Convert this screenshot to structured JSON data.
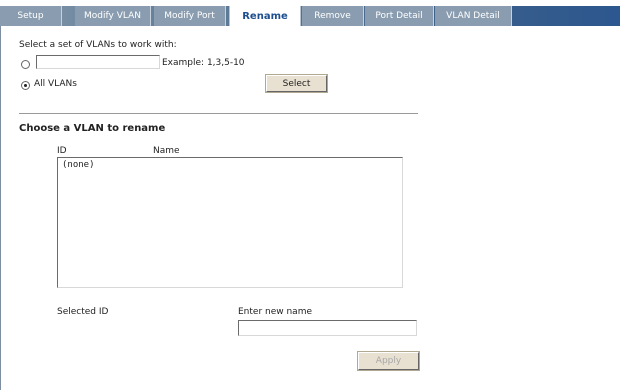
{
  "tabs": [
    {
      "label": "Setup",
      "active": false
    },
    {
      "label": "Modify VLAN",
      "active": false
    },
    {
      "label": "Modify Port",
      "active": false
    },
    {
      "label": "Rename",
      "active": true
    },
    {
      "label": "Remove",
      "active": false
    },
    {
      "label": "Port Detail",
      "active": false
    },
    {
      "label": "VLAN Detail",
      "active": false
    }
  ],
  "vlan_set": {
    "label": "Select a set of VLANs to work with:",
    "input_value": "",
    "example": "Example: 1,3,5-10",
    "all_label": "All VLANs",
    "selected_option": "all",
    "select_button": "Select"
  },
  "rename": {
    "heading": "Choose a VLAN to rename",
    "col_id": "ID",
    "col_name": "Name",
    "list_items": [
      "(none)"
    ],
    "selected_id_label": "Selected ID",
    "selected_id_value": "",
    "new_name_label": "Enter new name",
    "new_name_value": "",
    "apply_button": "Apply"
  },
  "colors": {
    "tab_bar_start": "#7f95a9",
    "tab_bar_end": "#2c578f",
    "active_tab_text": "#1d4e8f"
  }
}
